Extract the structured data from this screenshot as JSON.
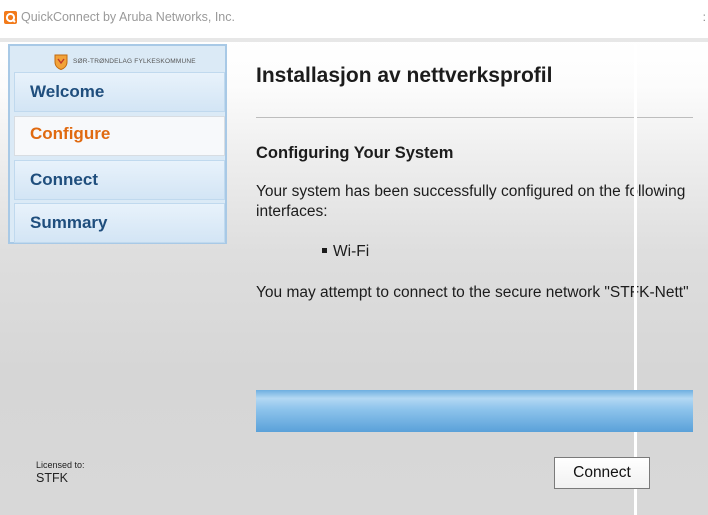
{
  "window": {
    "title": "QuickConnect by Aruba Networks, Inc.",
    "close_glyph": ":"
  },
  "brand": {
    "organization": "SØR-TRØNDELAG FYLKESKOMMUNE"
  },
  "steps": [
    {
      "label": "Welcome",
      "active": false
    },
    {
      "label": "Configure",
      "active": true
    },
    {
      "label": "Connect",
      "active": false
    },
    {
      "label": "Summary",
      "active": false
    }
  ],
  "content": {
    "title": "Installasjon av nettverksprofil",
    "subtitle": "Configuring Your System",
    "intro": "Your system has been successfully configured on the following interfaces:",
    "interfaces": [
      "Wi-Fi"
    ],
    "note": "You may attempt to connect to the secure network \"STFK-Nett\""
  },
  "progress": {
    "fraction": 1.0
  },
  "license": {
    "label": "Licensed to:",
    "value": "STFK"
  },
  "buttons": {
    "connect": "Connect"
  },
  "colors": {
    "step_text": "#1f4e7d",
    "active_step_text": "#e06a10",
    "progress": "#6eaee0",
    "app_icon": "#f27a1a"
  }
}
